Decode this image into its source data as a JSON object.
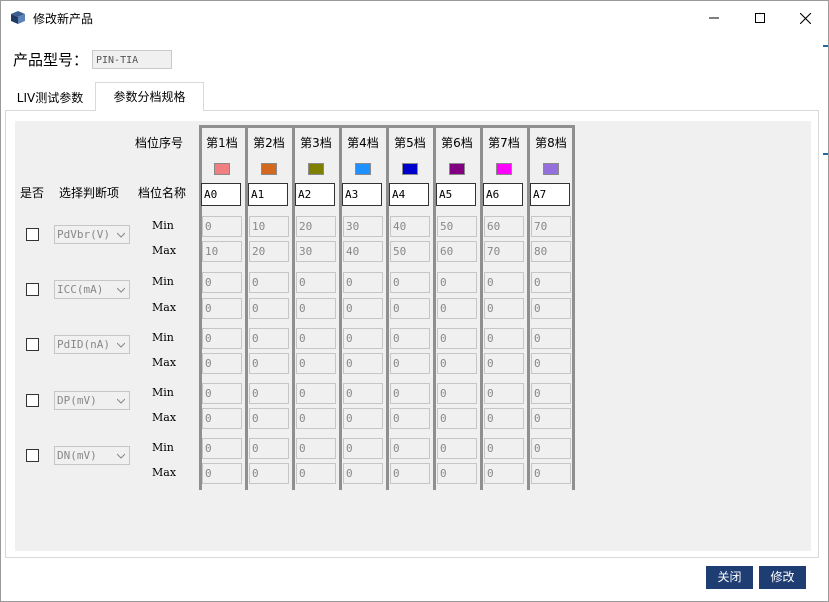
{
  "window": {
    "title": "修改新产品"
  },
  "product": {
    "label": "产品型号：",
    "model": "PIN-TIA"
  },
  "tabs": [
    {
      "label": "LIV测试参数"
    },
    {
      "label": "参数分档规格"
    }
  ],
  "grid": {
    "bin_index_label": "档位序号",
    "yes_no_label": "是否",
    "select_item_label": "选择判断项",
    "bin_name_label": "档位名称",
    "min_label": "Min",
    "max_label": "Max",
    "bins": [
      {
        "label": "第1档",
        "name": "A0",
        "color": "#f08080"
      },
      {
        "label": "第2档",
        "name": "A1",
        "color": "#d2691e"
      },
      {
        "label": "第3档",
        "name": "A2",
        "color": "#808000"
      },
      {
        "label": "第4档",
        "name": "A3",
        "color": "#1e90ff"
      },
      {
        "label": "第5档",
        "name": "A4",
        "color": "#0000cd"
      },
      {
        "label": "第6档",
        "name": "A5",
        "color": "#800080"
      },
      {
        "label": "第7档",
        "name": "A6",
        "color": "#ff00ff"
      },
      {
        "label": "第8档",
        "name": "A7",
        "color": "#9370db"
      }
    ],
    "params": [
      {
        "item": "PdVbr(V)",
        "checked": false,
        "min": [
          "0",
          "10",
          "20",
          "30",
          "40",
          "50",
          "60",
          "70"
        ],
        "max": [
          "10",
          "20",
          "30",
          "40",
          "50",
          "60",
          "70",
          "80"
        ]
      },
      {
        "item": "ICC(mA)",
        "checked": false,
        "min": [
          "0",
          "0",
          "0",
          "0",
          "0",
          "0",
          "0",
          "0"
        ],
        "max": [
          "0",
          "0",
          "0",
          "0",
          "0",
          "0",
          "0",
          "0"
        ]
      },
      {
        "item": "PdID(nA)",
        "checked": false,
        "min": [
          "0",
          "0",
          "0",
          "0",
          "0",
          "0",
          "0",
          "0"
        ],
        "max": [
          "0",
          "0",
          "0",
          "0",
          "0",
          "0",
          "0",
          "0"
        ]
      },
      {
        "item": "DP(mV)",
        "checked": false,
        "min": [
          "0",
          "0",
          "0",
          "0",
          "0",
          "0",
          "0",
          "0"
        ],
        "max": [
          "0",
          "0",
          "0",
          "0",
          "0",
          "0",
          "0",
          "0"
        ]
      },
      {
        "item": "DN(mV)",
        "checked": false,
        "min": [
          "0",
          "0",
          "0",
          "0",
          "0",
          "0",
          "0",
          "0"
        ],
        "max": [
          "0",
          "0",
          "0",
          "0",
          "0",
          "0",
          "0",
          "0"
        ]
      }
    ]
  },
  "buttons": {
    "close": "关闭",
    "modify": "修改"
  },
  "colors": {
    "button_bg": "#1e3d73",
    "panel_bg": "#f0f0f0"
  }
}
